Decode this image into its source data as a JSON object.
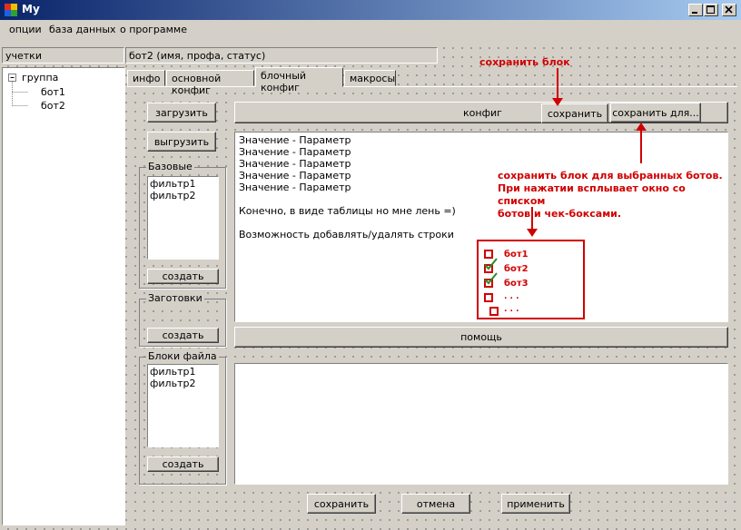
{
  "window": {
    "title": "My"
  },
  "menu": [
    "опции",
    "база данных",
    "о программе"
  ],
  "account_bar": {
    "label": "учетки",
    "bot_info": "бот2 (имя, профа, статус)"
  },
  "tree": {
    "group": "группа",
    "bots": [
      "бот1",
      "бот2"
    ]
  },
  "tabs": [
    "инфо",
    "основной конфиг",
    "блочный конфиг",
    "макросы"
  ],
  "left_panel": {
    "load_button": "загрузить",
    "unload_button": "выгрузить",
    "basic_group": {
      "label": "Базовые",
      "items": [
        "фильтр1",
        "фильтр2"
      ],
      "create_button": "создать"
    },
    "templates_group": {
      "label": "Заготовки",
      "create_button": "создать"
    },
    "file_blocks_group": {
      "label": "Блоки файла",
      "items": [
        "фильтр1",
        "фильтр2"
      ],
      "create_button": "создать"
    }
  },
  "config": {
    "header_label": "конфиг",
    "save_button": "сохранить",
    "save_for_button": "сохранить для...",
    "lines": [
      "Значение - Параметр",
      "Значение - Параметр",
      "Значение - Параметр",
      "Значение - Параметр",
      "Значение - Параметр"
    ],
    "note1": "Конечно, в виде таблицы но мне лень =)",
    "note2": "Возможность добавлять/удалять строки"
  },
  "help_label": "помощь",
  "annotations": {
    "save_block": "сохранить блок",
    "save_for_line1": "сохранить блок для выбранных ботов.",
    "save_for_line2": "При нажатии всплывает окно со списком",
    "save_for_line3": "ботов и чек-боксами."
  },
  "checkbox_mock": {
    "items": [
      "бот1",
      "бот2",
      "бот3",
      ". . .",
      ". . ."
    ],
    "checked": [
      false,
      true,
      true,
      false,
      false
    ]
  },
  "bottom_buttons": {
    "save": "сохранить",
    "cancel": "отмена",
    "apply": "применить"
  },
  "colors": {
    "annotation": "#d00000",
    "titlebar": "#0a246a",
    "check": "#2a8a2a"
  }
}
